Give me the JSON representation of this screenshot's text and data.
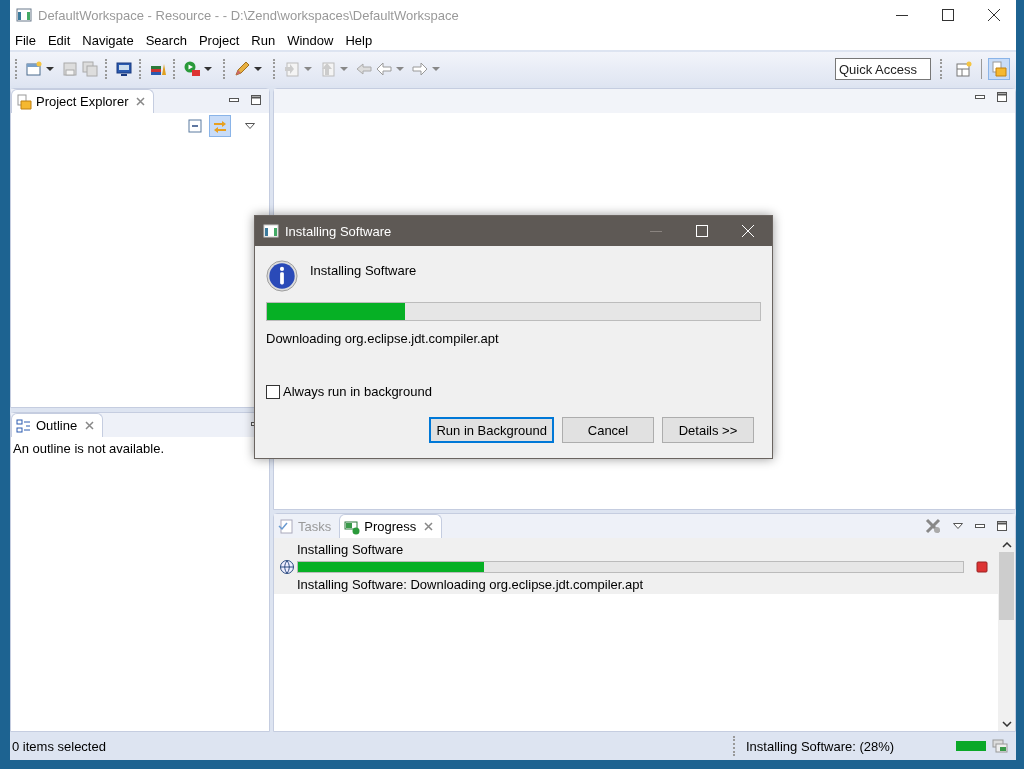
{
  "window": {
    "title": "DefaultWorkspace - Resource -  - D:\\Zend\\workspaces\\DefaultWorkspace"
  },
  "menu": [
    "File",
    "Edit",
    "Navigate",
    "Search",
    "Project",
    "Run",
    "Window",
    "Help"
  ],
  "quick_access": {
    "placeholder": "Quick Access"
  },
  "perspectives": [
    {
      "selected": false
    },
    {
      "selected": true
    }
  ],
  "project_explorer": {
    "tab": "Project Explorer",
    "link_with_editor": true
  },
  "outline": {
    "tab": "Outline",
    "message": "An outline is not available."
  },
  "bottom_panel": {
    "tabs": [
      {
        "label": "Tasks",
        "selected": false
      },
      {
        "label": "Progress",
        "selected": true
      }
    ],
    "jobs": [
      {
        "title": "Installing Software",
        "level": 0.28,
        "detail": "Installing Software: Downloading org.eclipse.jdt.compiler.apt"
      }
    ]
  },
  "dialog": {
    "title": "Installing Software",
    "heading": "Installing Software",
    "level": 0.28,
    "status": "Downloading org.eclipse.jdt.compiler.apt",
    "checkbox": {
      "label": "Always run in background",
      "checked": false
    },
    "buttons": [
      {
        "label": "Run in Background",
        "default": true
      },
      {
        "label": "Cancel",
        "default": false
      },
      {
        "label": "Details >>",
        "default": false
      }
    ]
  },
  "status_bar": {
    "selection": "0 items selected",
    "job": "Installing Software: (28%)"
  }
}
